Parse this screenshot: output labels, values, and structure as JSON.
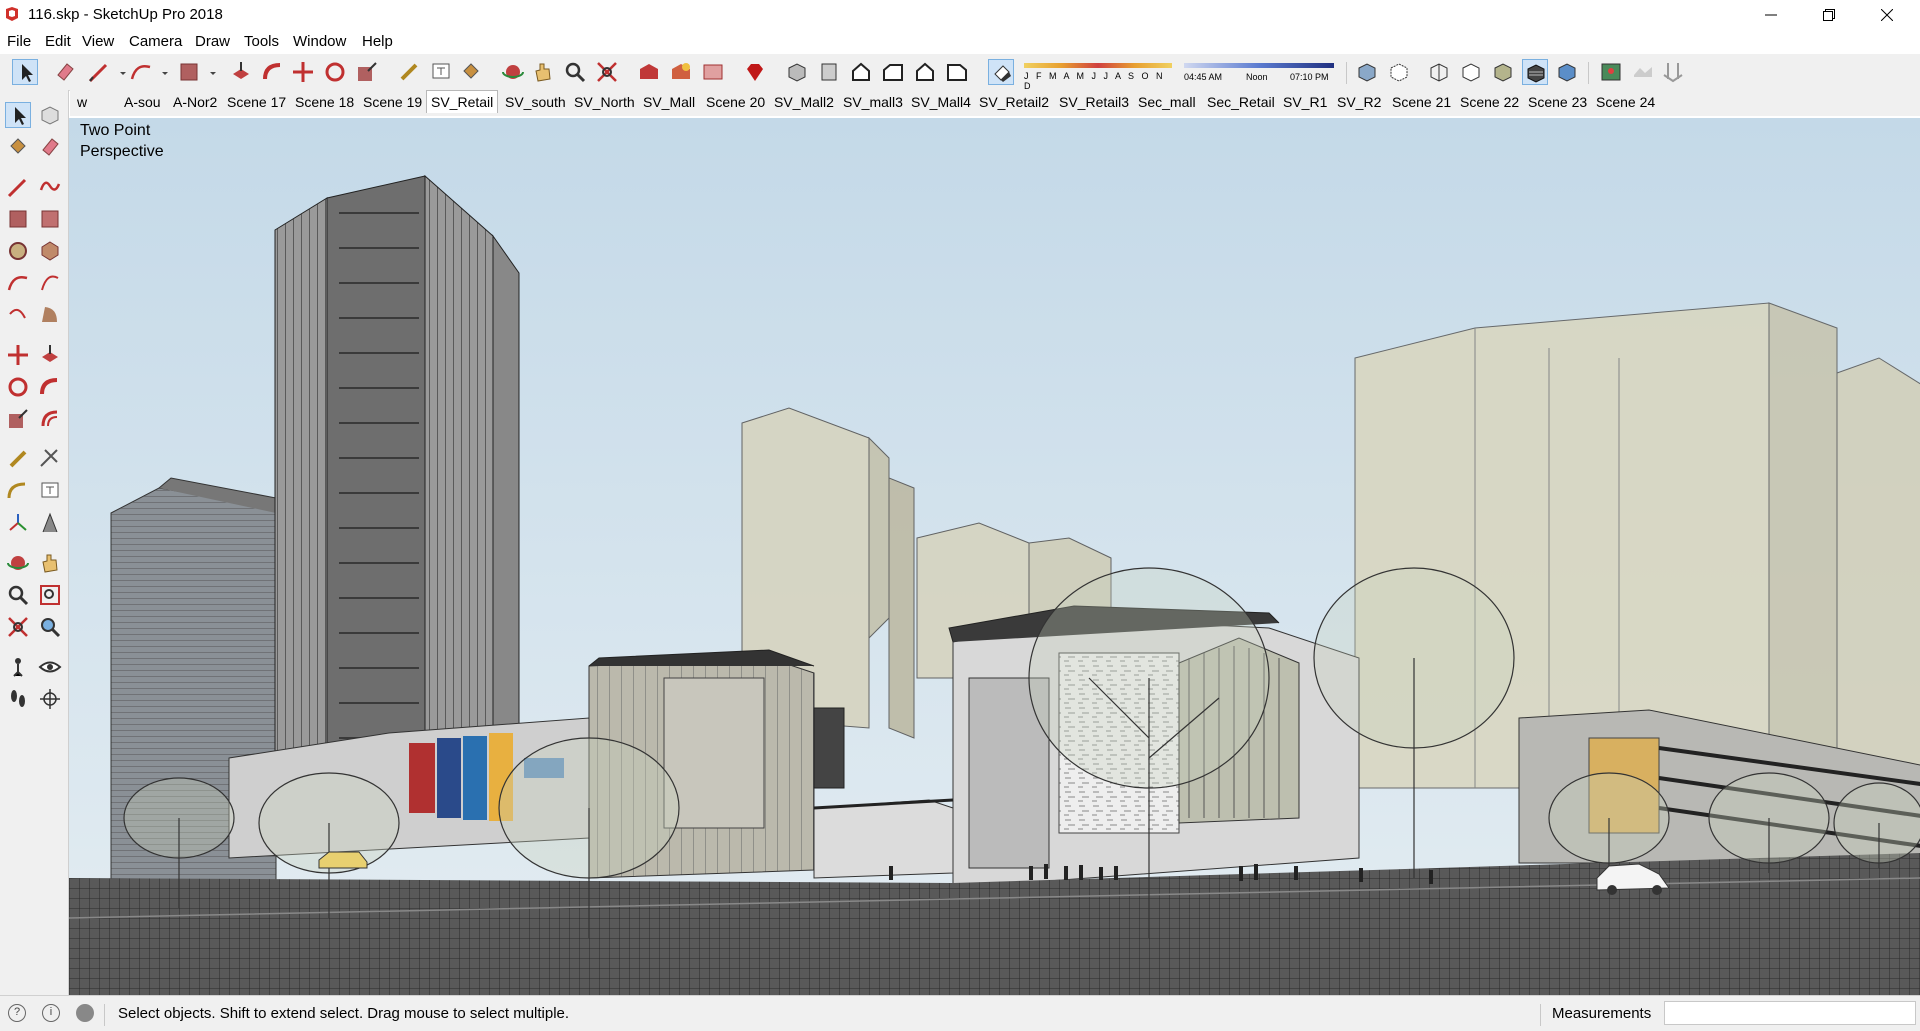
{
  "window": {
    "title": "116.skp - SketchUp Pro 2018"
  },
  "menu": [
    "File",
    "Edit",
    "View",
    "Camera",
    "Draw",
    "Tools",
    "Window",
    "Help"
  ],
  "shadow_panel": {
    "months": "J F M A M J J A S O N D",
    "time_start": "04:45 AM",
    "time_mid": "Noon",
    "time_end": "07:10 PM"
  },
  "scenes": {
    "tabs": [
      "w",
      "A-sou",
      "A-Nor2",
      "Scene 17",
      "Scene 18",
      "Scene 19",
      "SV_Retail",
      "SV_south",
      "SV_North",
      "SV_Mall",
      "Scene 20",
      "SV_Mall2",
      "SV_mall3",
      "SV_Mall4",
      "SV_Retail2",
      "SV_Retail3",
      "Sec_mall",
      "Sec_Retail",
      "SV_R1",
      "SV_R2",
      "Scene 21",
      "Scene 22",
      "Scene 23",
      "Scene 24"
    ],
    "active": "SV_Retail"
  },
  "viewport": {
    "camera_label_1": "Two Point",
    "camera_label_2": "Perspective"
  },
  "status": {
    "message": "Select objects. Shift to extend select. Drag mouse to select multiple.",
    "measurements_label": "Measurements",
    "measurements_value": ""
  },
  "colors": {
    "sky": "#c8dcea",
    "ground": "#5e5e5e",
    "accent_icon": "#d0302a"
  }
}
